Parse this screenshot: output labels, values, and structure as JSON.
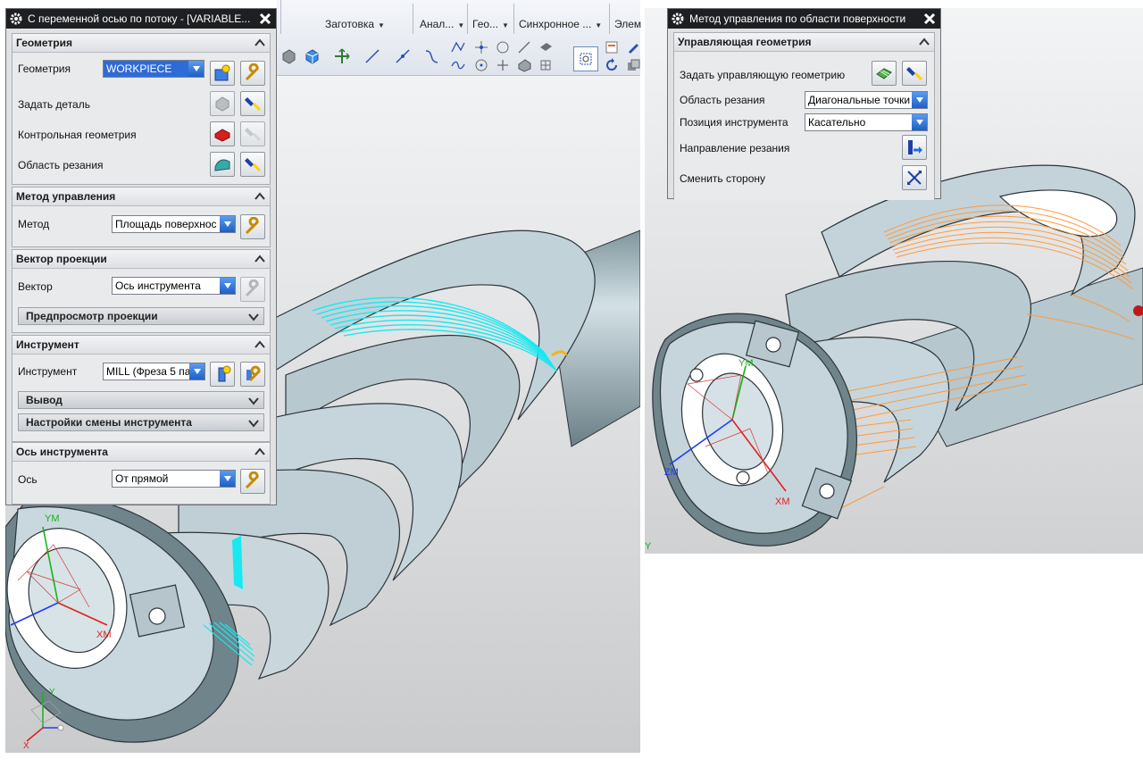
{
  "toolbar": {
    "groups": [
      {
        "label": "Заготовка"
      },
      {
        "label": "Анал..."
      },
      {
        "label": "Гео..."
      },
      {
        "label": "Синхронное ..."
      },
      {
        "label": "Элем"
      }
    ]
  },
  "left_dialog": {
    "title": "С переменной осью по потоку - [VARIABLE...",
    "sections": {
      "geometry": {
        "header": "Геометрия",
        "geometry_label": "Геометрия",
        "geometry_value": "WORKPIECE",
        "part_label": "Задать деталь",
        "check_label": "Контрольная геометрия",
        "cut_area_label": "Область резания"
      },
      "drive_method": {
        "header": "Метод управления",
        "method_label": "Метод",
        "method_value": "Площадь поверхнос"
      },
      "projection_vector": {
        "header": "Вектор проекции",
        "vector_label": "Вектор",
        "vector_value": "Ось инструмента",
        "preview_label": "Предпросмотр проекции"
      },
      "tool": {
        "header": "Инструмент",
        "tool_label": "Инструмент",
        "tool_value": "MILL (Фреза 5 па",
        "output_label": "Вывод",
        "tool_change_label": "Настройки смены инструмента"
      },
      "tool_axis": {
        "header": "Ось инструмента",
        "axis_label": "Ось",
        "axis_value": "От прямой"
      }
    }
  },
  "right_dialog": {
    "title": "Метод управления по области поверхности",
    "section_header": "Управляющая геометрия",
    "drive_geometry_label": "Задать управляющую геометрию",
    "cut_area_label": "Область резания",
    "cut_area_value": "Диагональные точки",
    "tool_position_label": "Позиция инструмента",
    "tool_position_value": "Касательно",
    "cut_direction_label": "Направление резания",
    "flip_side_label": "Сменить сторону"
  },
  "viewport_left": {
    "axis_labels": {
      "ym": "YM",
      "xm": "XM",
      "x": "X",
      "y": "Y"
    }
  },
  "viewport_right": {
    "axis_labels": {
      "ym": "YM",
      "zm": "ZM",
      "xm": "XM",
      "y": "Y"
    }
  },
  "colors": {
    "part": "#c4d4db",
    "part_dark": "#5e7278",
    "toolpath_left": "#19e8f0",
    "toolpath_right": "#ff9a3c",
    "dialog_title_bg": "#1d1f22",
    "selected_value_bg": "#2f6bd6"
  }
}
